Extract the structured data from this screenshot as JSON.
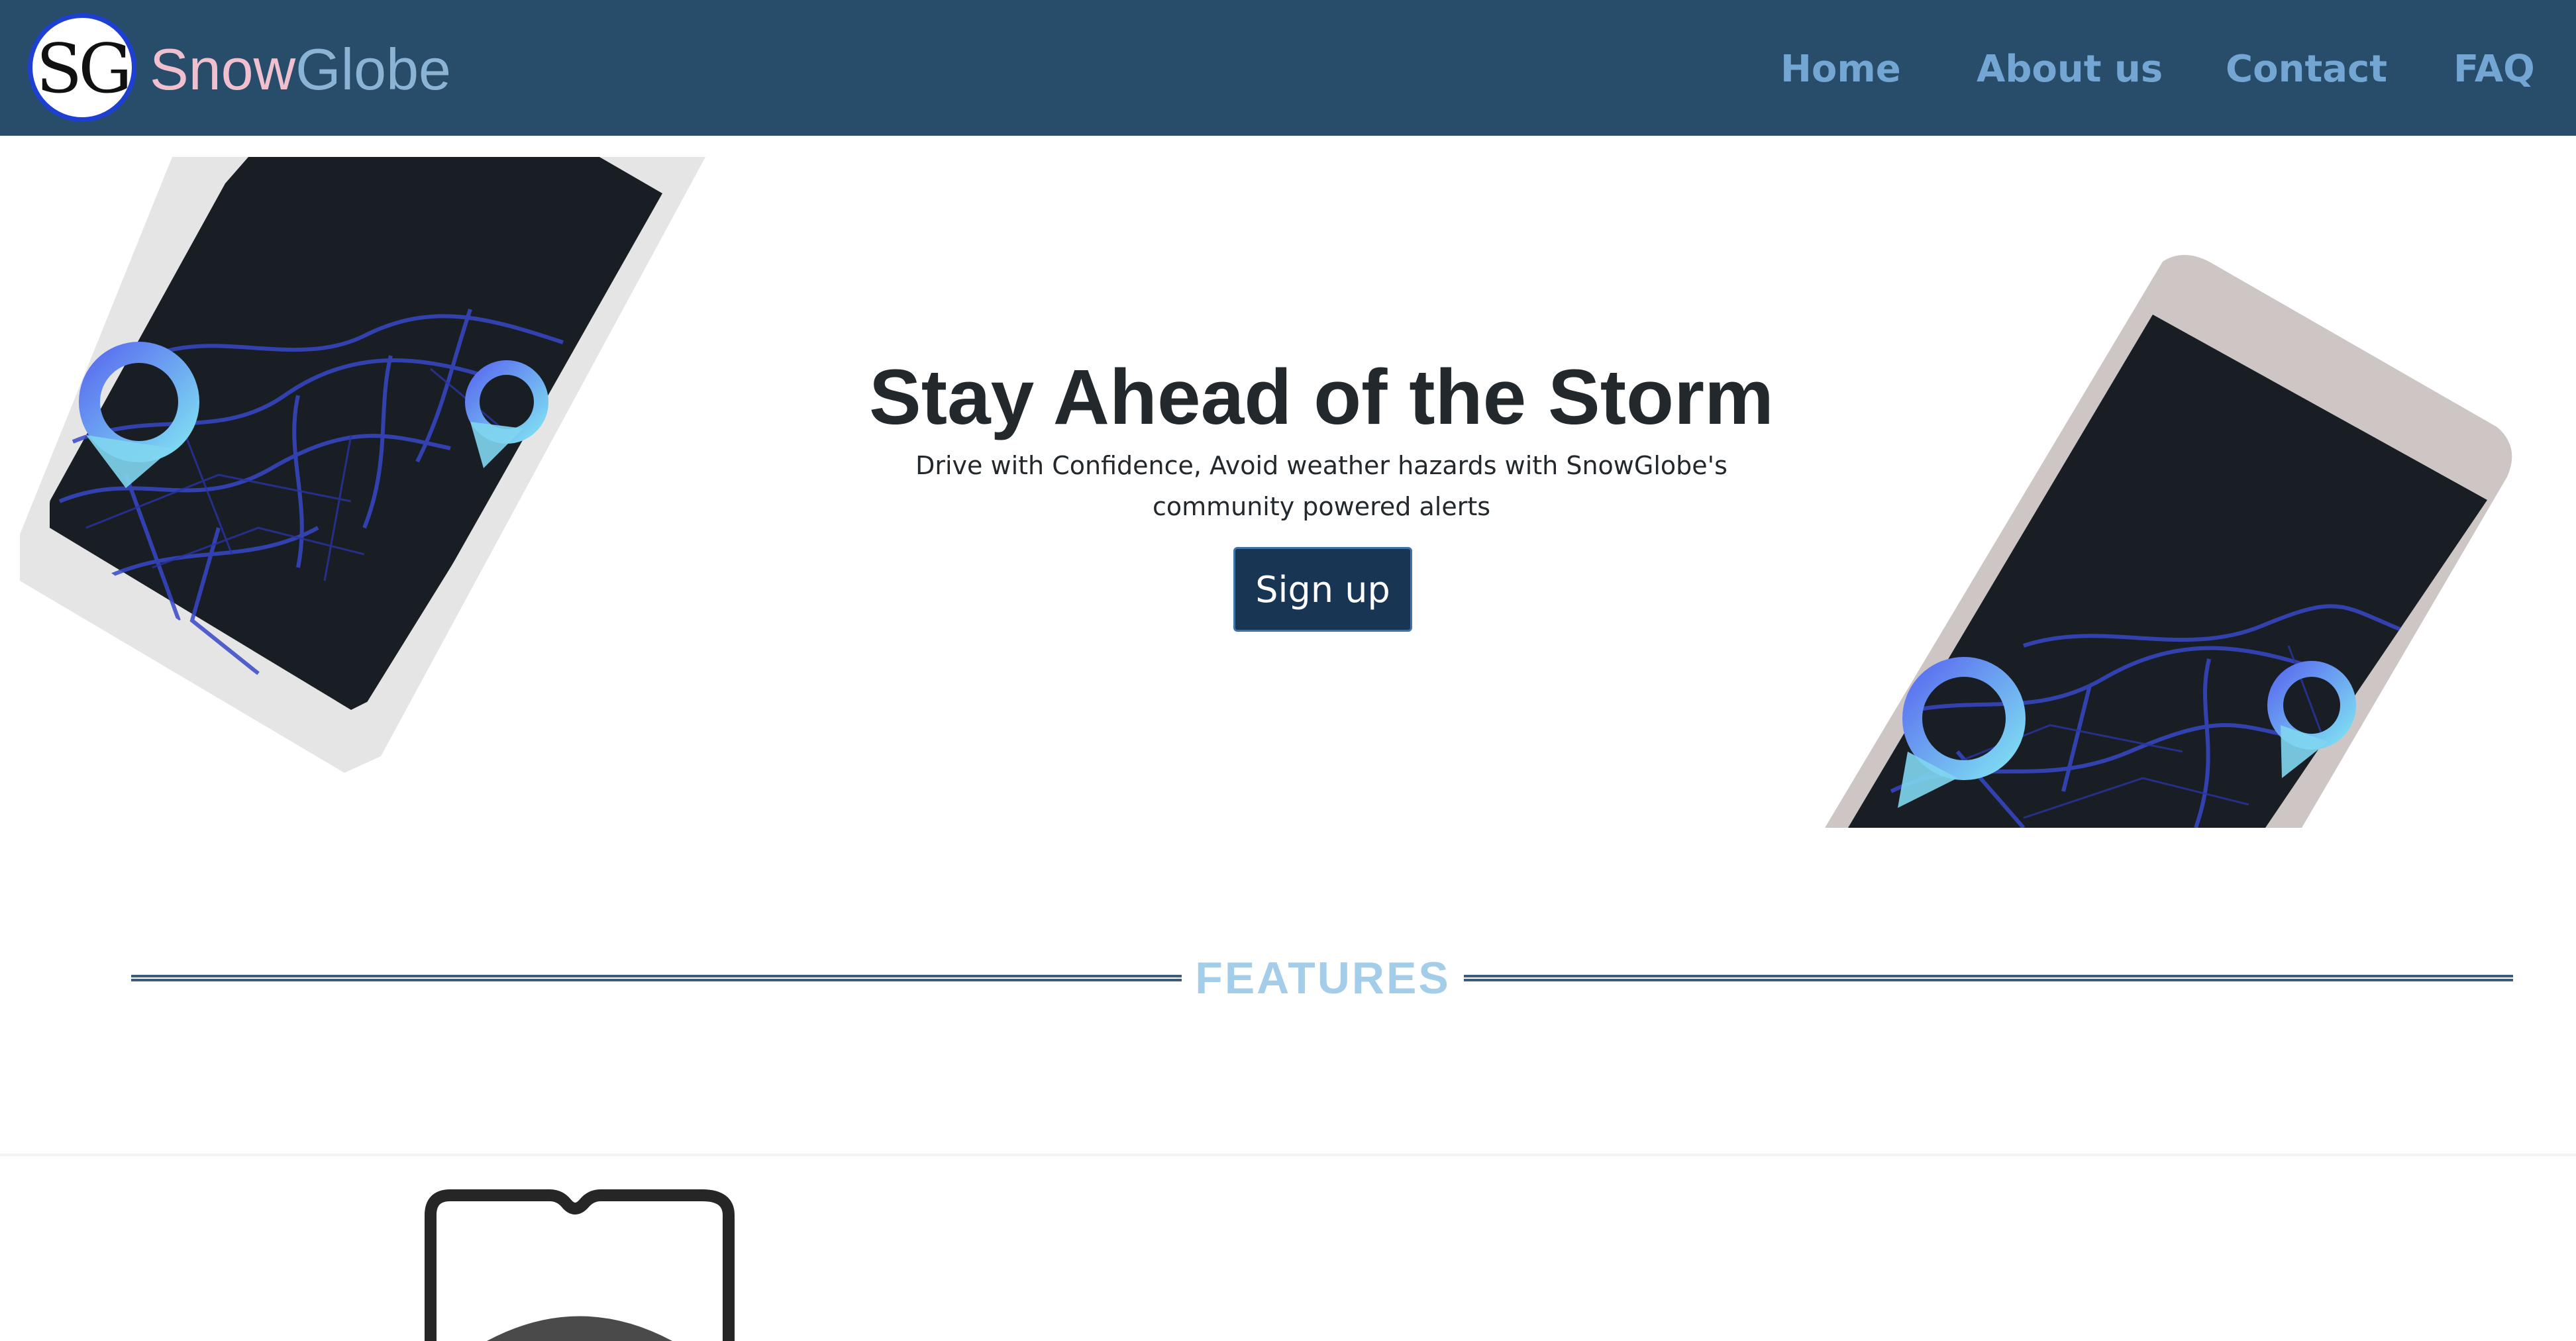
{
  "navbar": {
    "logo_text": "SG",
    "brand_part1": "Snow",
    "brand_part2": "Globe",
    "links": [
      "Home",
      "About us",
      "Contact",
      "FAQ"
    ]
  },
  "hero": {
    "title": "Stay Ahead of the Storm",
    "subtitle": "Drive with Confidence, Avoid weather hazards with SnowGlobe's community powered alerts",
    "signup_label": "Sign up"
  },
  "features": {
    "heading": "FEATURES"
  },
  "colors": {
    "navbar_bg": "#274d6a",
    "nav_link": "#74a6d3",
    "brand_snow": "#f0c0cf",
    "brand_globe": "#8ab3d4",
    "button_bg": "#183554",
    "features_heading": "#a4cdea"
  }
}
